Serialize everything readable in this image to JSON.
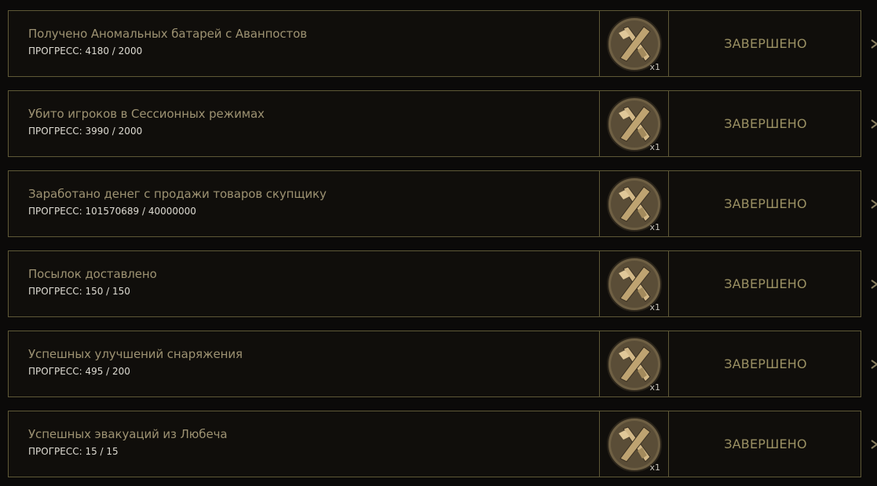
{
  "achievements": [
    {
      "title": "Получено Аномальных батарей с Аванпостов",
      "progress": "ПРОГРЕСС: 4180 / 2000",
      "reward_qty": "x1",
      "status": "ЗАВЕРШЕНО"
    },
    {
      "title": "Убито игроков в Сессионных режимах",
      "progress": "ПРОГРЕСС: 3990 / 2000",
      "reward_qty": "x1",
      "status": "ЗАВЕРШЕНО"
    },
    {
      "title": "Заработано денег с продажи товаров скупщику",
      "progress": "ПРОГРЕСС: 101570689 / 40000000",
      "reward_qty": "x1",
      "status": "ЗАВЕРШЕНО"
    },
    {
      "title": "Посылок доставлено",
      "progress": "ПРОГРЕСС: 150 / 150",
      "reward_qty": "x1",
      "status": "ЗАВЕРШЕНО"
    },
    {
      "title": "Успешных улучшений снаряжения",
      "progress": "ПРОГРЕСС: 495 / 200",
      "reward_qty": "x1",
      "status": "ЗАВЕРШЕНО"
    },
    {
      "title": "Успешных эвакуаций из Любеча",
      "progress": "ПРОГРЕСС: 15 / 15",
      "reward_qty": "x1",
      "status": "ЗАВЕРШЕНО"
    }
  ],
  "icons": {
    "reward": "crossed-tools-medal-icon",
    "edge": "partial-arrow-icon"
  },
  "colors": {
    "background": "#0b0a09",
    "border": "#5e5836",
    "title": "#9d9272",
    "progress": "#dedbd2",
    "status": "#9a9063",
    "medal": "#7a6a4a"
  }
}
